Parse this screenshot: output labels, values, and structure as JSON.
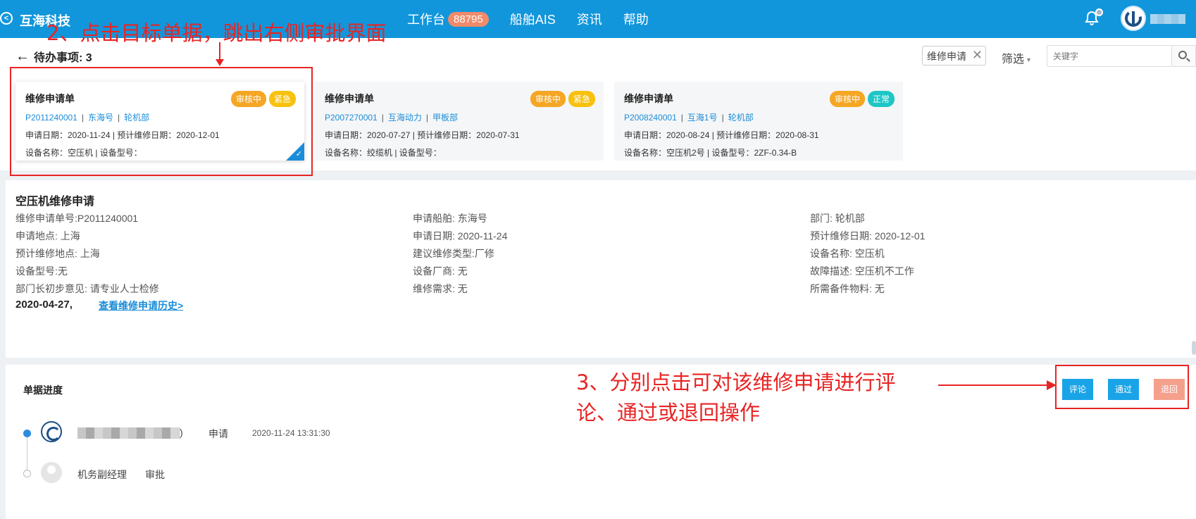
{
  "header": {
    "brand": "互海科技",
    "nav": [
      {
        "label": "工作台",
        "badge": "88795"
      },
      {
        "label": "船舶AIS"
      },
      {
        "label": "资讯"
      },
      {
        "label": "帮助"
      }
    ]
  },
  "todo": {
    "title": "待办事项: 3",
    "filter_tag": "维修申请",
    "filter_label": "筛选",
    "search_placeholder": "关键字",
    "cards": [
      {
        "title": "维修申请单",
        "status": "审核中",
        "priority": "紧急",
        "code": "P2011240001",
        "ship": "东海号",
        "dept": "轮机部",
        "dates": "申请日期：2020-11-24 | 预计维修日期：2020-12-01",
        "equipment": "设备名称：空压机 | 设备型号："
      },
      {
        "title": "维修申请单",
        "status": "审核中",
        "priority": "紧急",
        "code": "P2007270001",
        "ship": "互海动力",
        "dept": "甲板部",
        "dates": "申请日期：2020-07-27 | 预计维修日期：2020-07-31",
        "equipment": "设备名称：绞缆机 | 设备型号："
      },
      {
        "title": "维修申请单",
        "status": "审核中",
        "priority": "正常",
        "code": "P2008240001",
        "ship": "互海1号",
        "dept": "轮机部",
        "dates": "申请日期：2020-08-24 | 预计维修日期：2020-08-31",
        "equipment": "设备名称：空压机2号 | 设备型号：2ZF-0.34-B"
      }
    ]
  },
  "detail": {
    "title": "空压机维修申请",
    "fields": {
      "order_no": "维修申请单号:P2011240001",
      "ship": "申请船舶: 东海号",
      "dept": "部门: 轮机部",
      "location": "申请地点: 上海",
      "apply_date": "申请日期: 2020-11-24",
      "expected_date": "预计维修日期: 2020-12-01",
      "expected_location": "预计维修地点: 上海",
      "repair_type": "建议维修类型:厂修",
      "equipment_name": "设备名称: 空压机",
      "model": "设备型号:无",
      "maker": "设备厂商: 无",
      "fault": "故障描述: 空压机不工作",
      "head_opinion": "部门长初步意见: 请专业人士检修",
      "need": "维修需求: 无",
      "parts": "所需备件物料: 无"
    },
    "date_highlight": "2020-04-27,",
    "history_link": "查看维修申请历史>"
  },
  "progress": {
    "title": "单据进度",
    "steps": [
      {
        "user_suffix": ")",
        "action": "申请",
        "time": "2020-11-24 13:31:30"
      },
      {
        "user": "机务副经理",
        "action": "审批"
      }
    ],
    "actions": {
      "comment": "评论",
      "approve": "通过",
      "reject": "退回"
    }
  },
  "annotations": {
    "step2": "2、点击目标单据，跳出右侧审批界面",
    "step3_line1": "3、分别点击可对该维修申请进行评",
    "step3_line2": "论、通过或退回操作"
  },
  "colors": {
    "header": "#1296db",
    "accent": "#1a8cd8",
    "annotation": "#e82424",
    "audit": "#f5a623",
    "urgent": "#f7c10e",
    "normal": "#1ec6c6",
    "reject": "#f4a08c"
  }
}
